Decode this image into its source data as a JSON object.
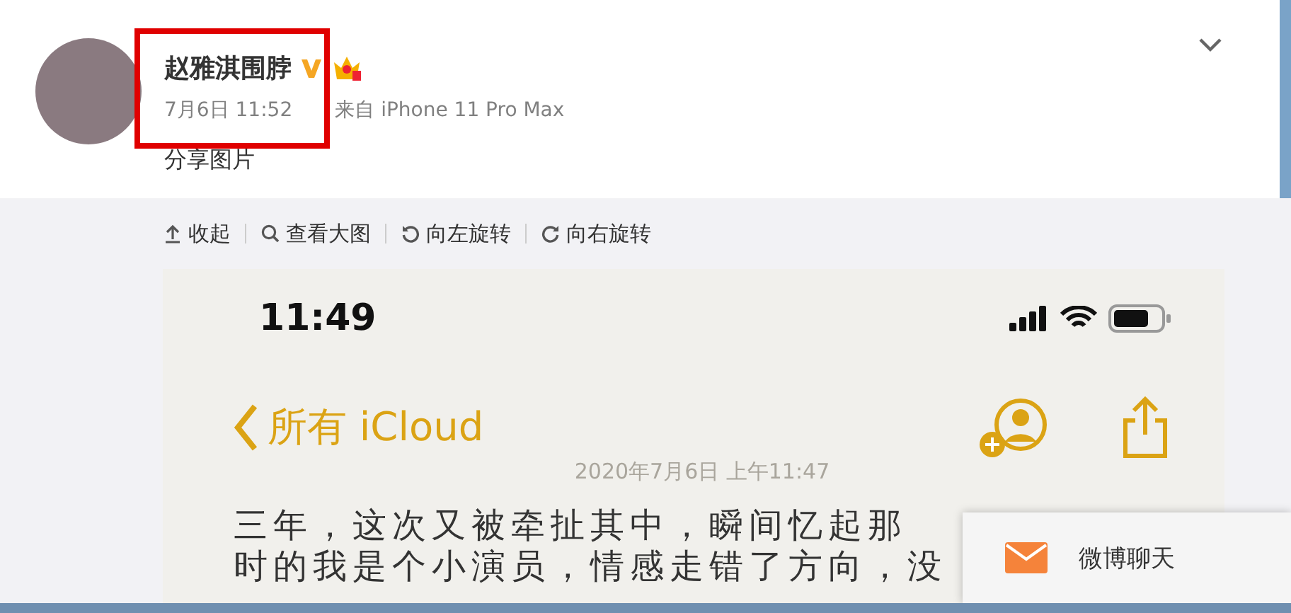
{
  "post": {
    "author": "赵雅淇围脖",
    "time": "7月6日 11:52",
    "source": "来自 iPhone 11 Pro Max",
    "text": "分享图片",
    "highlighted": true
  },
  "toolbar": [
    {
      "label": "收起",
      "kind": "collapse"
    },
    {
      "label": "查看大图",
      "kind": "zoom"
    },
    {
      "label": "向左旋转",
      "kind": "rotate_left"
    },
    {
      "label": "向右旋转",
      "kind": "rotate_right"
    }
  ],
  "image": {
    "clock": "11:49",
    "back_label": "所有 iCloud",
    "date": "2020年7月6日 上午11:47",
    "lines": [
      "三年，这次又被牵扯其中，瞬间忆起那",
      "时的我是个小演员，情感走错了方向，没"
    ]
  },
  "chat_popup": {
    "label": "微博聊天"
  }
}
